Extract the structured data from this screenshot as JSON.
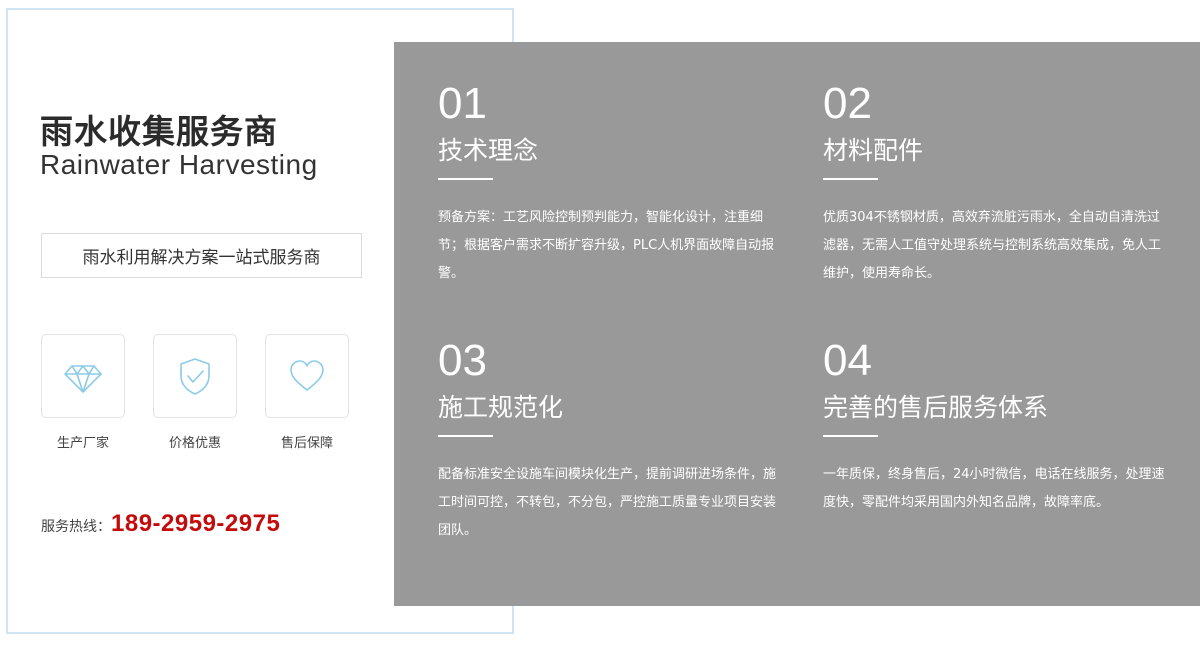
{
  "brand": {
    "title_cn": "雨水收集服务商",
    "title_en": "Rainwater Harvesting",
    "slogan": "雨水利用解决方案一站式服务商"
  },
  "features": [
    {
      "label": "生产厂家",
      "icon": "diamond-icon"
    },
    {
      "label": "价格优惠",
      "icon": "shield-check-icon"
    },
    {
      "label": "售后保障",
      "icon": "heart-icon"
    }
  ],
  "hotline": {
    "label": "服务热线：",
    "number": "189-2959-2975"
  },
  "items": [
    {
      "num": "01",
      "title": "技术理念",
      "desc": "预备方案：工艺风险控制预判能力，智能化设计，注重细节；根据客户需求不断扩容升级，PLC人机界面故障自动报警。"
    },
    {
      "num": "02",
      "title": "材料配件",
      "desc": "优质304不锈钢材质，高效弃流脏污雨水，全自动自清洗过滤器，无需人工值守处理系统与控制系统高效集成，免人工维护，使用寿命长。"
    },
    {
      "num": "03",
      "title": "施工规范化",
      "desc": "配备标准安全设施车间模块化生产，提前调研进场条件，施工时间可控，不转包，不分包，严控施工质量专业项目安装团队。"
    },
    {
      "num": "04",
      "title": "完善的售后服务体系",
      "desc": "一年质保，终身售后，24小时微信，电话在线服务，处理速度快，零配件均采用国内外知名品牌，故障率底。"
    }
  ],
  "colors": {
    "panel_bg": "#999999",
    "hotline_number": "#c40b0b",
    "icon_stroke": "#8ccbe8",
    "card_border": "#cfe6f2"
  }
}
